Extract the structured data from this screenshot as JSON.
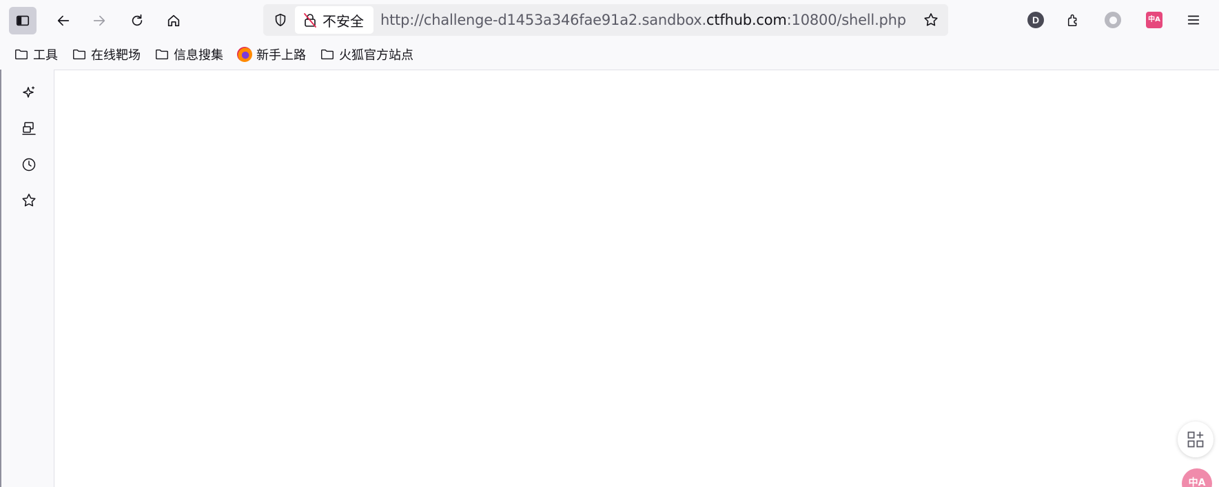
{
  "toolbar": {
    "url_prefix": "http://challenge-d1453a346fae91a2.sandbox.",
    "url_domain": "ctfhub.com",
    "url_suffix": ":10800/shell.php",
    "insecure_label": "不安全",
    "account_initial": "D",
    "translate_ext_label": "中A"
  },
  "bookmarks": [
    {
      "label": "工具",
      "icon": "folder-icon"
    },
    {
      "label": "在线靶场",
      "icon": "folder-icon"
    },
    {
      "label": "信息搜集",
      "icon": "folder-icon"
    },
    {
      "label": "新手上路",
      "icon": "firefox-icon"
    },
    {
      "label": "火狐官方站点",
      "icon": "folder-icon"
    }
  ],
  "sidebar": {
    "items": [
      {
        "icon": "sparkle-icon"
      },
      {
        "icon": "synced-tabs-icon"
      },
      {
        "icon": "history-icon"
      },
      {
        "icon": "bookmarks-star-icon"
      }
    ]
  },
  "content": {
    "floating_translate_label": "中A"
  }
}
